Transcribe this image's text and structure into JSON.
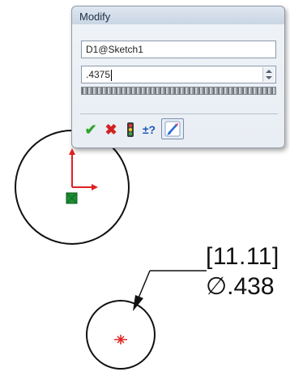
{
  "dialog": {
    "title": "Modify",
    "dimension_name": "D1@Sketch1",
    "value": ".4375",
    "buttons": {
      "ok": "✔",
      "cancel": "✖",
      "rebuild": "traffic-light-icon",
      "reverse": "±?",
      "mark": "mark-dimension-icon"
    }
  },
  "annotation": {
    "dual_dimension": "[11.11]",
    "diameter": "∅.438"
  },
  "colors": {
    "ok": "#2da62d",
    "cancel": "#d32121",
    "origin_axis": "#e02020",
    "dialog_border": "#8f9aa6"
  }
}
